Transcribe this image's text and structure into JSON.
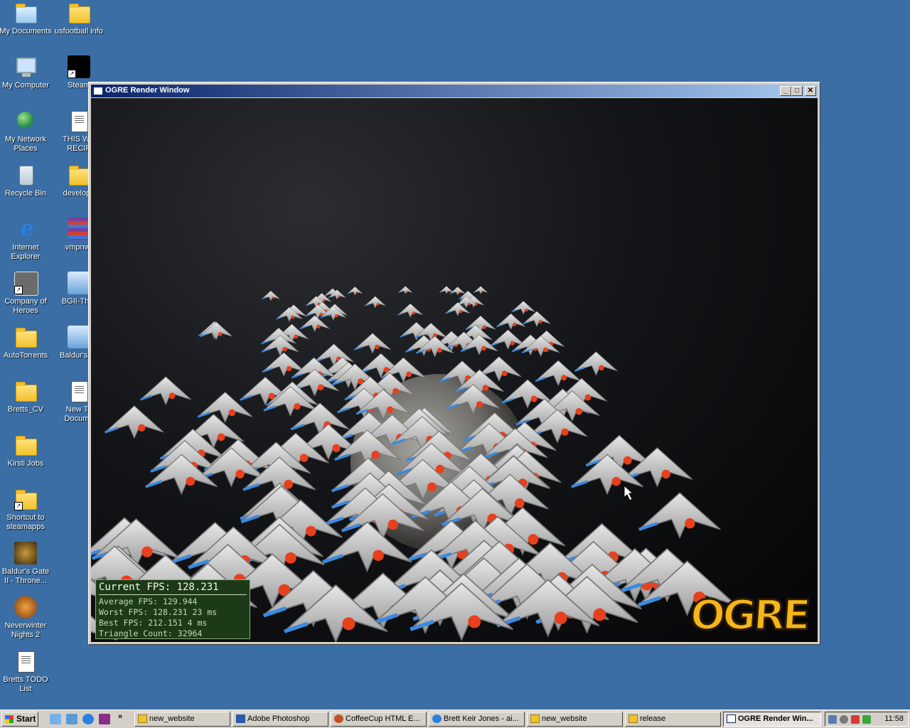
{
  "desktop": {
    "icons": [
      {
        "label": "My Documents",
        "icon": "my-documents-icon"
      },
      {
        "label": "usfootball info",
        "icon": "folder-icon"
      },
      {
        "label": "My Computer",
        "icon": "my-computer-icon"
      },
      {
        "label": "Steam",
        "icon": "steam-icon"
      },
      {
        "label": "My Network\nPlaces",
        "icon": "network-places-icon"
      },
      {
        "label": "THIS WE\nRECIP",
        "icon": "word-document-icon"
      },
      {
        "label": "Recycle Bin",
        "icon": "recycle-bin-icon"
      },
      {
        "label": "develop_",
        "icon": "folder-icon"
      },
      {
        "label": "Internet\nExplorer",
        "icon": "internet-explorer-icon"
      },
      {
        "label": "vmpnwr",
        "icon": "winrar-archive-icon"
      },
      {
        "label": "Company of\nHeroes",
        "icon": "company-of-heroes-icon"
      },
      {
        "label": "BGII-Thro",
        "icon": "installer-icon"
      },
      {
        "label": "AutoTorrents",
        "icon": "folder-icon"
      },
      {
        "label": "Baldur'sGa",
        "icon": "installer-icon"
      },
      {
        "label": "Bretts_CV",
        "icon": "folder-icon"
      },
      {
        "label": "New Te\nDocume",
        "icon": "text-document-icon"
      },
      {
        "label": "Kirsti Jobs",
        "icon": "folder-icon"
      },
      {
        "label": "Shortcut to\nsteamapps",
        "icon": "folder-shortcut-icon"
      },
      {
        "label": "Baldur's Gate\nII - Throne...",
        "icon": "baldurs-gate-icon"
      },
      {
        "label": "Neverwinter\nNights 2",
        "icon": "neverwinter-nights-icon"
      },
      {
        "label": "Bretts TODO\nList",
        "icon": "text-document-icon"
      }
    ]
  },
  "window": {
    "title": "OGRE Render Window",
    "min_label": "_",
    "max_label": "□",
    "close_label": "✕",
    "stats": {
      "current": "Current FPS: 128.231",
      "average": "Average FPS: 129.944",
      "worst": "Worst FPS: 128.231 23 ms",
      "best": "Best FPS: 212.151 4 ms",
      "triangles": "Triangle Count: 32964"
    },
    "logo": "OGRE"
  },
  "taskbar": {
    "start_label": "Start",
    "chevron": "»",
    "items": [
      {
        "label": "new_website",
        "icon": "folder-icon"
      },
      {
        "label": "Adobe Photoshop",
        "icon": "photoshop-icon"
      },
      {
        "label": "CoffeeCup HTML E...",
        "icon": "coffeecup-icon"
      },
      {
        "label": "Brett Keir Jones - ai...",
        "icon": "internet-explorer-icon"
      },
      {
        "label": "new_website",
        "icon": "folder-icon"
      },
      {
        "label": "release",
        "icon": "folder-icon"
      },
      {
        "label": "OGRE Render Win...",
        "icon": "window-icon"
      }
    ],
    "clock": "11:58"
  },
  "colors": {
    "desktop": "#3a6ea5",
    "titlebar_start": "#0a246a",
    "titlebar_end": "#a6caf0",
    "stats_panel": "#1d3a18",
    "logo": "#f5b619"
  }
}
